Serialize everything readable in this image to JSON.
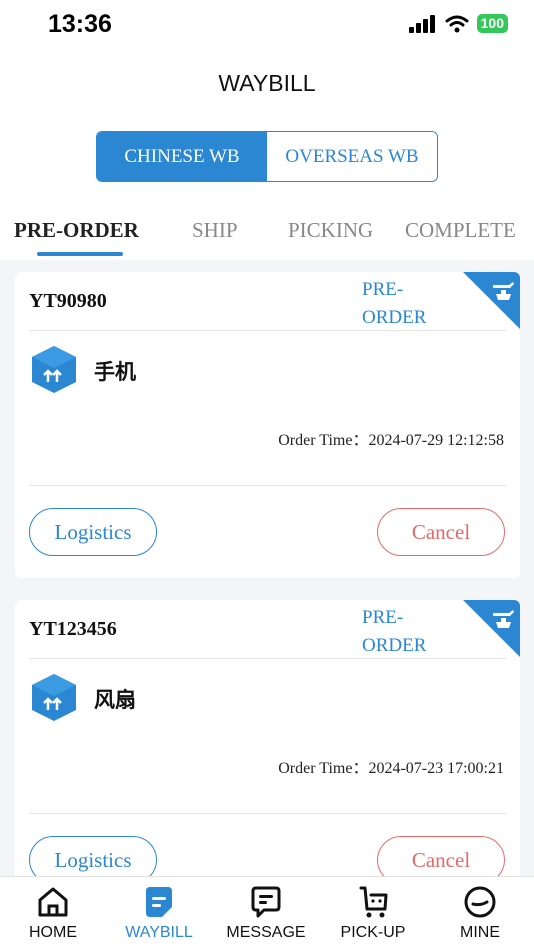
{
  "status_bar": {
    "time": "13:36",
    "battery": "100"
  },
  "header": {
    "title": "WAYBILL"
  },
  "segment": {
    "chinese": "CHINESE WB",
    "overseas": "OVERSEAS WB",
    "selected": "CHINESE WB"
  },
  "tabs": [
    {
      "label": "PRE-ORDER",
      "active": true
    },
    {
      "label": "SHIP",
      "active": false
    },
    {
      "label": "PICKING",
      "active": false
    },
    {
      "label": "COMPLETE",
      "active": false
    }
  ],
  "orders": [
    {
      "id": "YT90980",
      "status": "PRE-ORDER",
      "goods": "手机",
      "time_label": "Order Time：",
      "time": "2024-07-29 12:12:58",
      "logistics": "Logistics",
      "cancel": "Cancel"
    },
    {
      "id": "YT123456",
      "status": "PRE-ORDER",
      "goods": "风扇",
      "time_label": "Order Time：",
      "time": "2024-07-23 17:00:21",
      "logistics": "Logistics",
      "cancel": "Cancel"
    }
  ],
  "tabbar": [
    {
      "label": "HOME",
      "icon": "home-icon",
      "active": false
    },
    {
      "label": "WAYBILL",
      "icon": "waybill-icon",
      "active": true
    },
    {
      "label": "MESSAGE",
      "icon": "message-icon",
      "active": false
    },
    {
      "label": "PICK-UP",
      "icon": "pickup-icon",
      "active": false
    },
    {
      "label": "MINE",
      "icon": "mine-icon",
      "active": false
    }
  ],
  "colors": {
    "accent": "#2b87d1",
    "cancel": "#e46a6a",
    "battery": "#34c759"
  }
}
